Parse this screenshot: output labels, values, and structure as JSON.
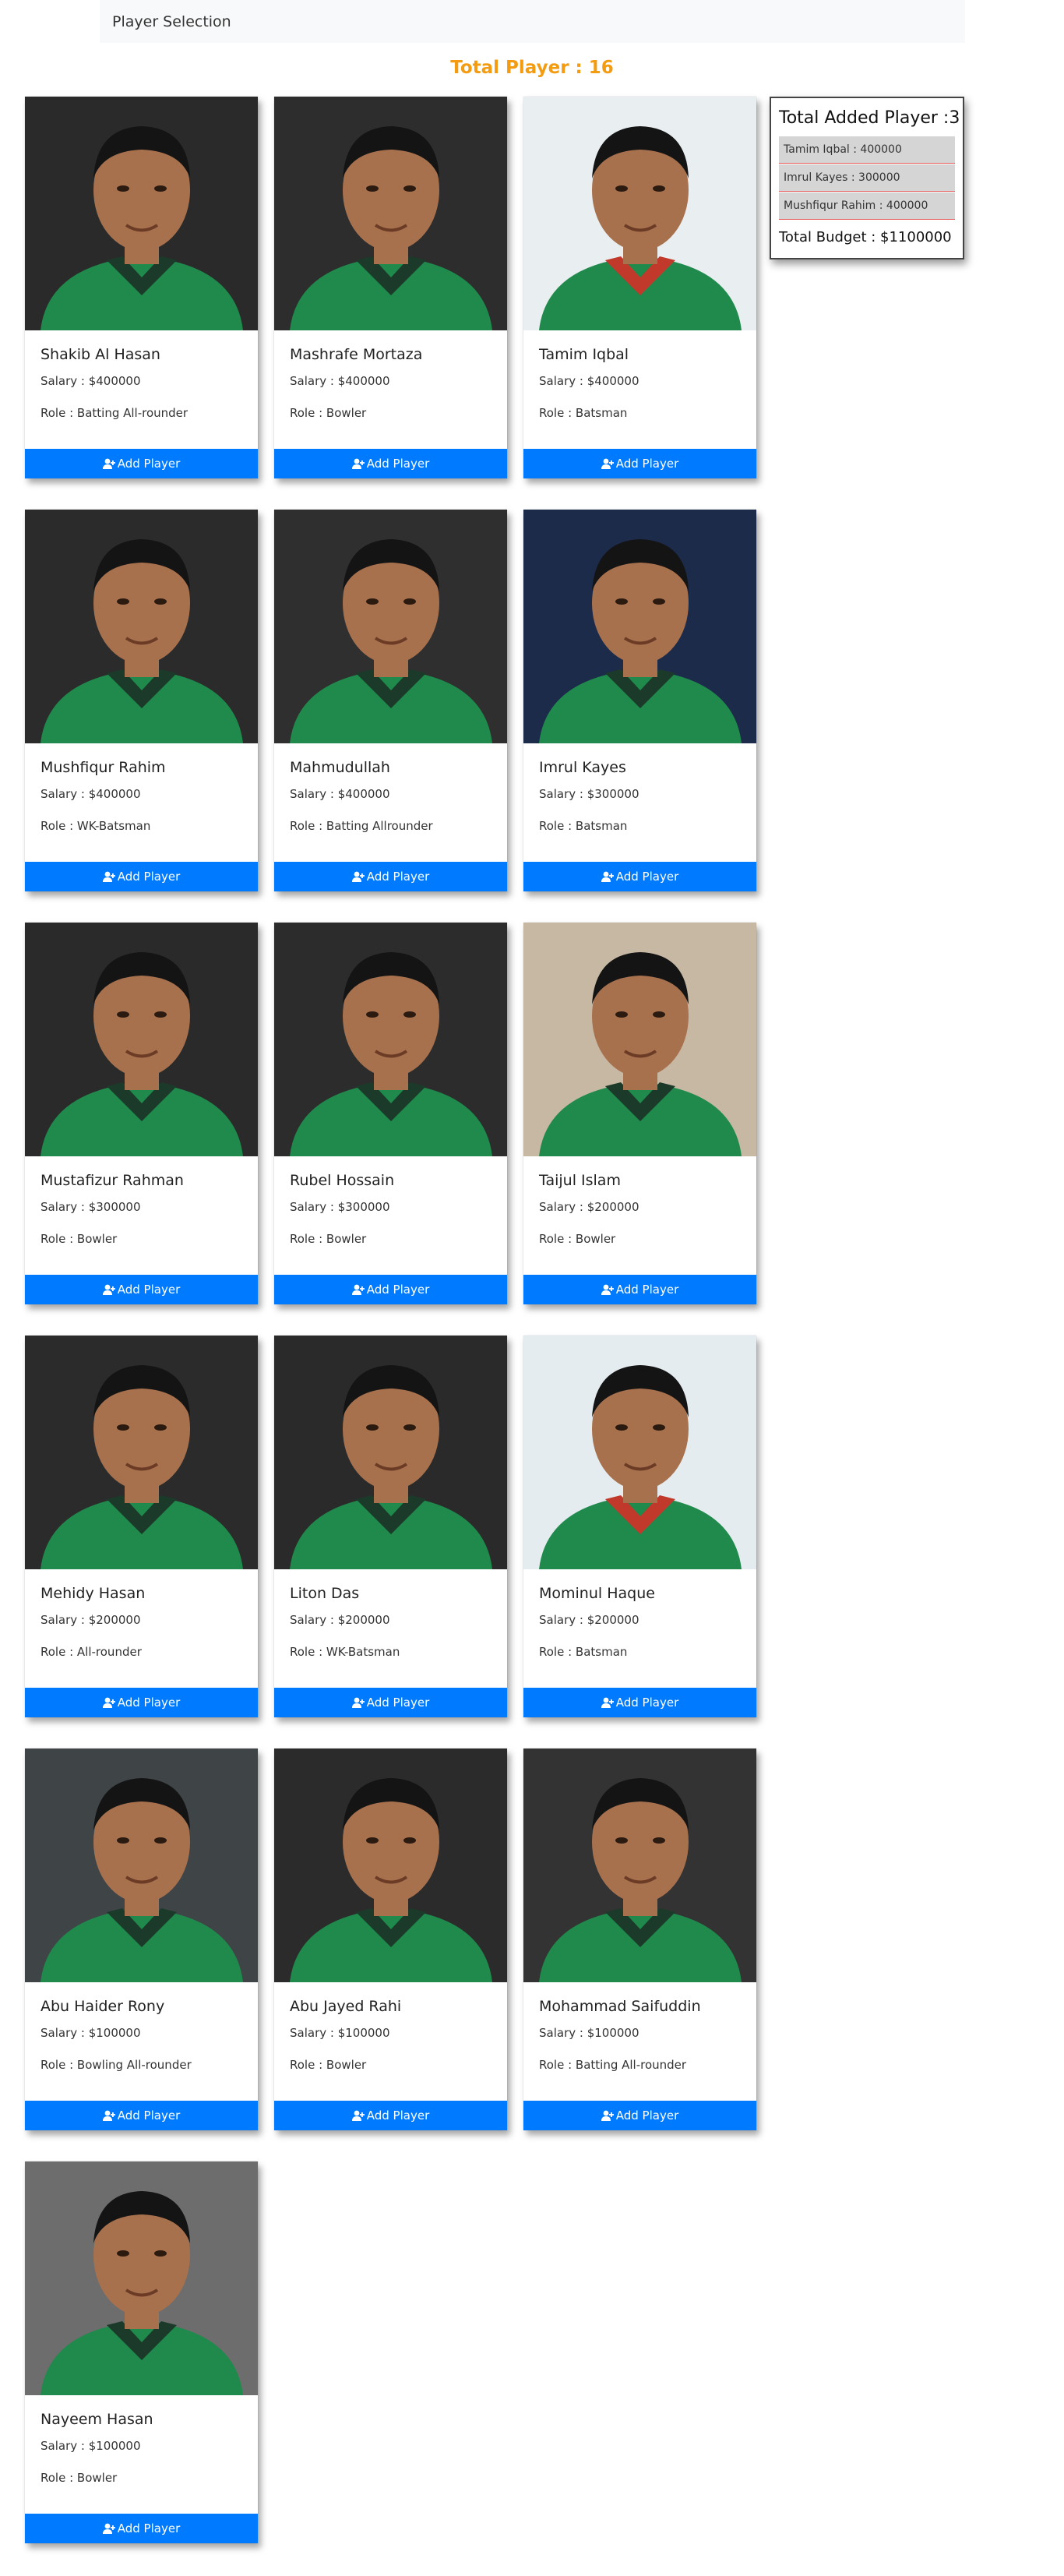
{
  "navbar": {
    "brand": "Player Selection"
  },
  "header": {
    "total_players": "Total Player : 16"
  },
  "summary": {
    "title": "Total Added Player :3",
    "items": [
      "Tamim Iqbal : 400000",
      "Imrul Kayes : 300000",
      "Mushfiqur Rahim : 400000"
    ],
    "budget": "Total Budget : $1100000"
  },
  "button_label": "Add Player",
  "players": [
    {
      "name": "Shakib Al Hasan",
      "salary": "Salary : $400000",
      "role": "Role : Batting All-rounder"
    },
    {
      "name": "Mashrafe Mortaza",
      "salary": "Salary : $400000",
      "role": "Role : Bowler"
    },
    {
      "name": "Tamim Iqbal",
      "salary": "Salary : $400000",
      "role": "Role : Batsman"
    },
    {
      "name": "Mushfiqur Rahim",
      "salary": "Salary : $400000",
      "role": "Role : WK-Batsman"
    },
    {
      "name": "Mahmudullah",
      "salary": "Salary : $400000",
      "role": "Role : Batting Allrounder"
    },
    {
      "name": "Imrul Kayes",
      "salary": "Salary : $300000",
      "role": "Role : Batsman"
    },
    {
      "name": "Mustafizur Rahman",
      "salary": "Salary : $300000",
      "role": "Role : Bowler"
    },
    {
      "name": "Rubel Hossain",
      "salary": "Salary : $300000",
      "role": "Role : Bowler"
    },
    {
      "name": "Taijul Islam",
      "salary": "Salary : $200000",
      "role": "Role : Bowler"
    },
    {
      "name": "Mehidy Hasan",
      "salary": "Salary : $200000",
      "role": "Role : All-rounder"
    },
    {
      "name": "Liton Das",
      "salary": "Salary : $200000",
      "role": "Role : WK-Batsman"
    },
    {
      "name": "Mominul Haque",
      "salary": "Salary : $200000",
      "role": "Role : Batsman"
    },
    {
      "name": "Abu Haider Rony",
      "salary": "Salary : $100000",
      "role": "Role : Bowling All-rounder"
    },
    {
      "name": "Abu Jayed Rahi",
      "salary": "Salary : $100000",
      "role": "Role : Bowler"
    },
    {
      "name": "Mohammad Saifuddin",
      "salary": "Salary : $100000",
      "role": "Role : Batting All-rounder"
    },
    {
      "name": "Nayeem Hasan",
      "salary": "Salary : $100000",
      "role": "Role : Bowler"
    }
  ],
  "colors": {
    "accent": "#f39c12",
    "button": "#007bff",
    "jersey_green": "#1f8a4c",
    "jersey_red": "#c0392b"
  }
}
